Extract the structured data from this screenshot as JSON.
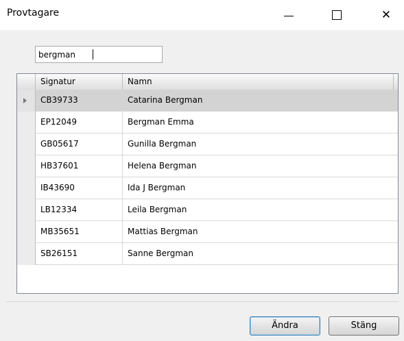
{
  "window": {
    "title": "Provtagare",
    "close_glyph": "✕"
  },
  "search": {
    "value": "bergman"
  },
  "grid": {
    "columns": [
      "Signatur",
      "Namn"
    ],
    "rows": [
      {
        "signatur": "CB39733",
        "namn": "Catarina Bergman",
        "selected": true
      },
      {
        "signatur": "EP12049",
        "namn": "Bergman Emma"
      },
      {
        "signatur": "GB05617",
        "namn": "Gunilla Bergman"
      },
      {
        "signatur": "HB37601",
        "namn": "Helena Bergman"
      },
      {
        "signatur": "IB43690",
        "namn": "Ida J Bergman"
      },
      {
        "signatur": "LB12334",
        "namn": "Leila Bergman"
      },
      {
        "signatur": "MB35651",
        "namn": "Mattias Bergman"
      },
      {
        "signatur": "SB26151",
        "namn": "Sanne Bergman"
      }
    ]
  },
  "buttons": {
    "andra": "Ändra",
    "stang": "Stäng"
  },
  "colors": {
    "selected_row": "#d3d3d3",
    "focus_border": "#3c7fb1"
  }
}
